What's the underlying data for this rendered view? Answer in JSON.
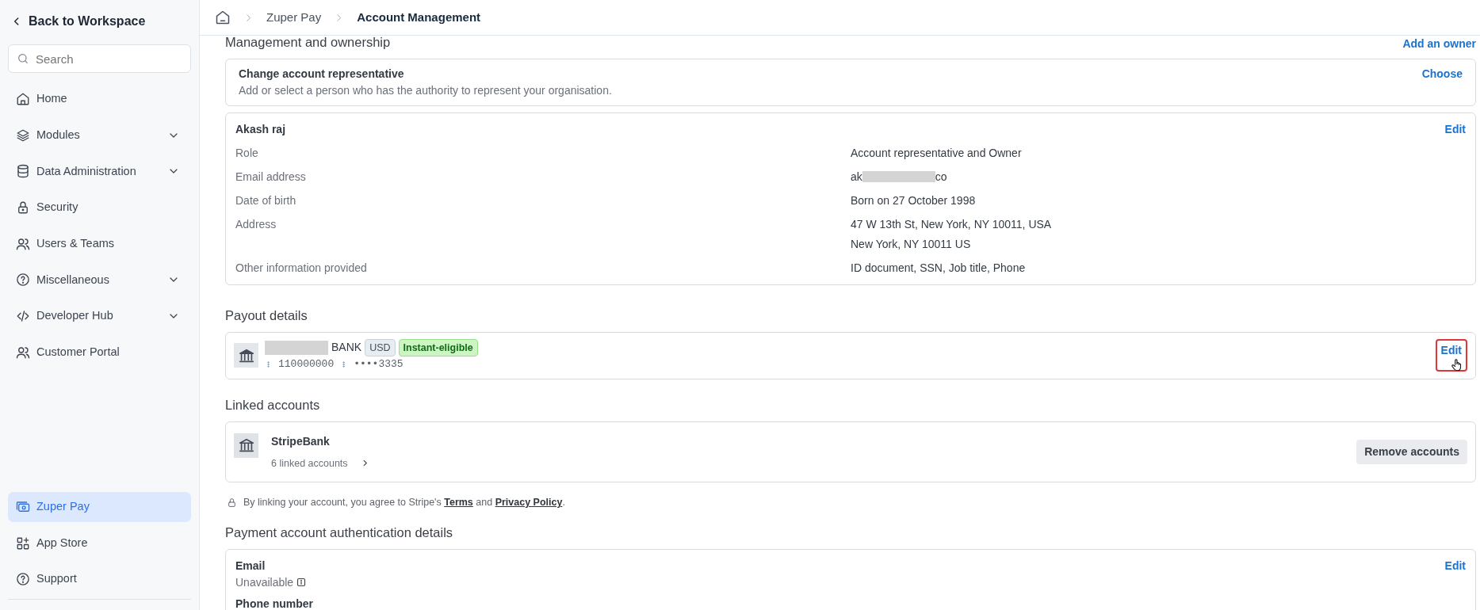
{
  "sidebar": {
    "back": "Back to Workspace",
    "search": {
      "placeholder": "Search"
    },
    "items": [
      {
        "label": "Home",
        "expandable": false,
        "selected": false
      },
      {
        "label": "Modules",
        "expandable": true,
        "selected": false
      },
      {
        "label": "Data Administration",
        "expandable": true,
        "selected": false
      },
      {
        "label": "Security",
        "expandable": false,
        "selected": false
      },
      {
        "label": "Users & Teams",
        "expandable": false,
        "selected": false
      },
      {
        "label": "Miscellaneous",
        "expandable": true,
        "selected": false
      },
      {
        "label": "Developer Hub",
        "expandable": true,
        "selected": false
      },
      {
        "label": "Customer Portal",
        "expandable": false,
        "selected": false
      }
    ],
    "bottom_items": [
      {
        "label": "Zuper Pay",
        "selected": true
      },
      {
        "label": "App Store",
        "selected": false
      },
      {
        "label": "Support",
        "selected": false
      }
    ]
  },
  "breadcrumb": [
    "Zuper Pay",
    "Account Management"
  ],
  "management": {
    "title": "Management and ownership",
    "action": "Add an owner",
    "change_rep": {
      "title": "Change account representative",
      "description": "Add or select a person who has the authority to represent your organisation.",
      "action": "Choose"
    },
    "person": {
      "name": "Akash raj",
      "action": "Edit",
      "rows": [
        {
          "label": "Role",
          "lines": [
            "Account representative and Owner"
          ],
          "redacted": false
        },
        {
          "label": "Email address",
          "lines": [
            "ak",
            "co"
          ],
          "redacted": true
        },
        {
          "label": "Date of birth",
          "lines": [
            "Born on 27 October 1998"
          ],
          "redacted": false
        },
        {
          "label": "Address",
          "lines": [
            "47 W 13th St, New York, NY 10011, USA",
            "New York, NY 10011 US"
          ],
          "redacted": false
        },
        {
          "label": "Other information provided",
          "lines": [
            "ID document, SSN, Job title, Phone"
          ],
          "redacted": false
        }
      ]
    }
  },
  "payout": {
    "title": "Payout details",
    "name_redacted": true,
    "bank": "BANK",
    "currency": "USD",
    "tag": "Instant-eligible",
    "routing": "110000000",
    "account": "••••3335",
    "action": "Edit",
    "highlighted": true
  },
  "linked": {
    "title": "Linked accounts",
    "name": "StripeBank",
    "count": "6 linked accounts",
    "action": "Remove accounts"
  },
  "terms": {
    "before": "By linking your account, you agree to Stripe's",
    "links": [
      "Terms",
      "Privacy Policy"
    ],
    "joiner": "and",
    "end": "."
  },
  "auth": {
    "title": "Payment account authentication details",
    "fields": [
      {
        "label": "Email",
        "value": "Unavailable",
        "info": true,
        "action": "Edit"
      },
      {
        "label": "Phone number"
      }
    ]
  }
}
